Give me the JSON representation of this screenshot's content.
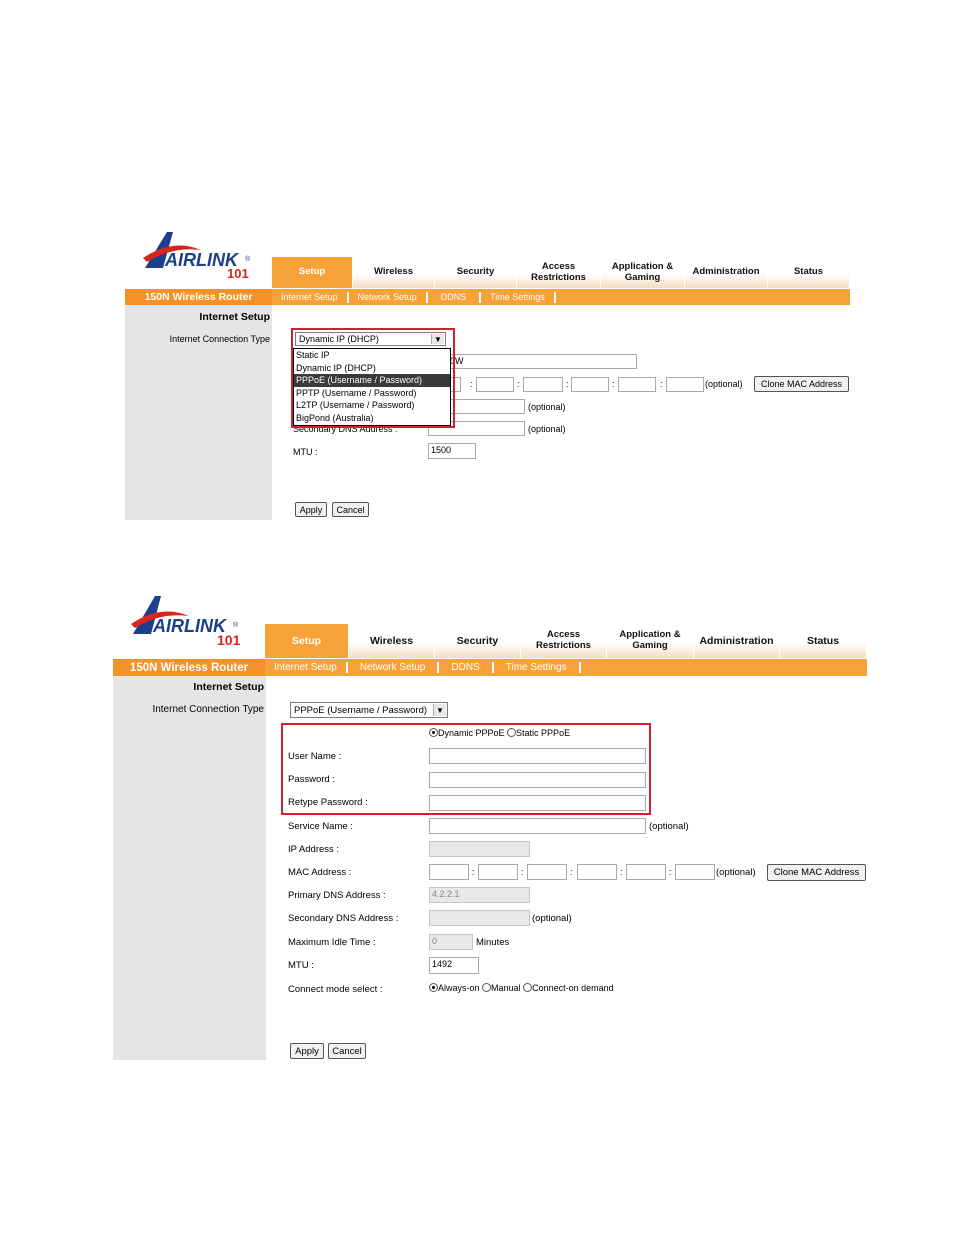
{
  "brand": {
    "logo_word": "AIRLINK",
    "logo_number": "101",
    "logo_registered": "®",
    "product_name": "150N Wireless Router"
  },
  "nav": {
    "tabs": [
      {
        "label": "Setup"
      },
      {
        "label": "Wireless"
      },
      {
        "label": "Security"
      },
      {
        "label": "Access Restrictions"
      },
      {
        "label": "Application & Gaming"
      },
      {
        "label": "Administration"
      },
      {
        "label": "Status"
      }
    ],
    "subtabs": [
      {
        "label": "Internet Setup"
      },
      {
        "label": "Network Setup"
      },
      {
        "label": "DDNS"
      },
      {
        "label": "Time Settings"
      }
    ]
  },
  "colors": {
    "accent": "#f7a239",
    "sidebar": "#e5e5e5",
    "highlight_box": "#d0222a"
  },
  "screen1": {
    "section_heading": "Internet Setup",
    "connection_type_label": "Internet Connection Type",
    "connection_type_selected": "Dynamic IP (DHCP)",
    "dropdown_options": [
      "Static IP",
      "Dynamic IP (DHCP)",
      "PPPoE (Username / Password)",
      "PPTP (Username / Password)",
      "L2TP (Username / Password)",
      "BigPond (Australia)"
    ],
    "dropdown_highlighted": "PPPoE (Username / Password)",
    "host_value_partial": "0W",
    "mac_optional": "(optional)",
    "clone_mac_button": "Clone MAC Address",
    "primary_dns_optional": "(optional)",
    "secondary_dns_label": "Secondary DNS Address :",
    "secondary_dns_optional": "(optional)",
    "mtu_label": "MTU :",
    "mtu_value": "1500",
    "apply_button": "Apply",
    "cancel_button": "Cancel"
  },
  "screen2": {
    "section_heading": "Internet Setup",
    "connection_type_label": "Internet Connection Type",
    "connection_type_selected": "PPPoE (Username / Password)",
    "pppoe_mode": {
      "dynamic_label": "Dynamic PPPoE",
      "static_label": "Static PPPoE",
      "selected": "Dynamic PPPoE"
    },
    "user_name_label": "User Name :",
    "user_name_value": "",
    "password_label": "Password :",
    "password_value": "",
    "retype_password_label": "Retype Password :",
    "retype_password_value": "",
    "service_name_label": "Service Name :",
    "service_name_value": "",
    "service_name_optional": "(optional)",
    "ip_address_label": "IP Address :",
    "mac_address_label": "MAC Address :",
    "mac_optional": "(optional)",
    "clone_mac_button": "Clone MAC Address",
    "primary_dns_label": "Primary DNS Address :",
    "primary_dns_value": "4.2.2.1",
    "secondary_dns_label": "Secondary DNS Address :",
    "secondary_dns_optional": "(optional)",
    "max_idle_label": "Maximum Idle Time :",
    "max_idle_value": "0",
    "max_idle_unit": "Minutes",
    "mtu_label": "MTU :",
    "mtu_value": "1492",
    "connect_mode_label": "Connect mode select :",
    "connect_modes": [
      "Always-on",
      "Manual",
      "Connect-on demand"
    ],
    "connect_mode_selected": "Always-on",
    "apply_button": "Apply",
    "cancel_button": "Cancel"
  }
}
